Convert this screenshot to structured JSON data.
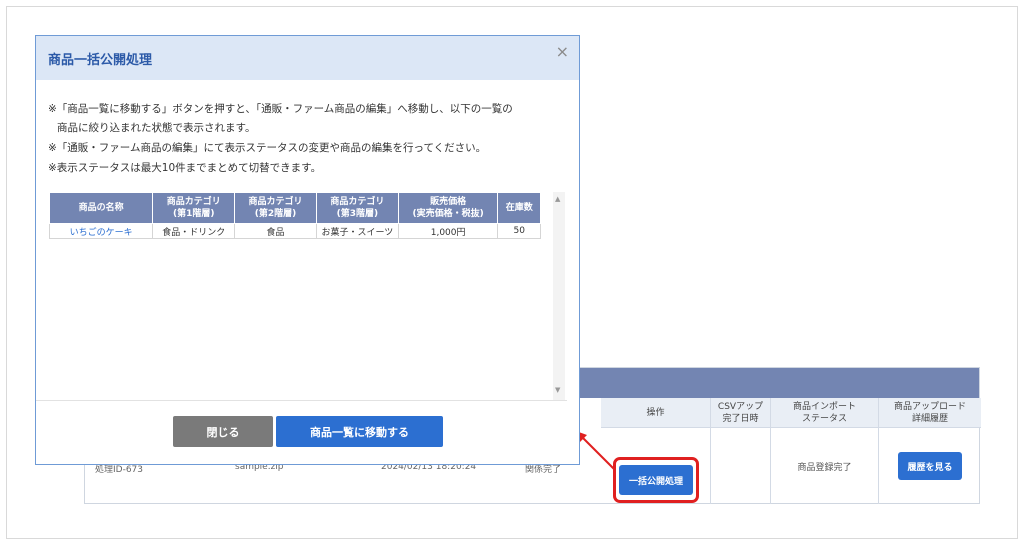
{
  "background": {
    "table_headers": {
      "op": "操作",
      "csv": "CSVアップ\n完了日時",
      "import": "商品インポート\nステータス",
      "history": "商品アップロード\n詳細履歴"
    },
    "row": {
      "id": "処理ID-673",
      "file": "sample.zip",
      "date": "2024/02/13 18:20:24",
      "status_cut": "関係完了",
      "bulk_button": "一括公開処理",
      "import_status": "商品登録完了",
      "history_button": "履歴を見る"
    },
    "colors": {
      "header_bar": "#7385b2",
      "button": "#2c6fd1",
      "highlight": "#e02020"
    }
  },
  "modal": {
    "title": "商品一括公開処理",
    "close_icon": "×",
    "notes": [
      "※「商品一覧に移動する」ボタンを押すと、「通販・ファーム商品の編集」へ移動し、以下の一覧の",
      "商品に絞り込まれた状態で表示されます。",
      "※「通販・ファーム商品の編集」にて表示ステータスの変更や商品の編集を行ってください。",
      "※表示ステータスは最大10件までまとめて切替できます。"
    ],
    "table": {
      "headers": [
        "商品の名称",
        "商品カテゴリ\n(第1階層)",
        "商品カテゴリ\n(第2階層)",
        "商品カテゴリ\n(第3階層)",
        "販売価格\n(実売価格・税抜)",
        "在庫数"
      ],
      "rows": [
        [
          "いちごのケーキ",
          "食品・ドリンク",
          "食品",
          "お菓子・スイーツ",
          "1,000円",
          "50"
        ]
      ]
    },
    "buttons": {
      "close": "閉じる",
      "goto_list": "商品一覧に移動する"
    },
    "colors": {
      "close_button": "#7a7a7a",
      "primary_button": "#2c6fd1",
      "title": "#2c5aa8"
    }
  }
}
